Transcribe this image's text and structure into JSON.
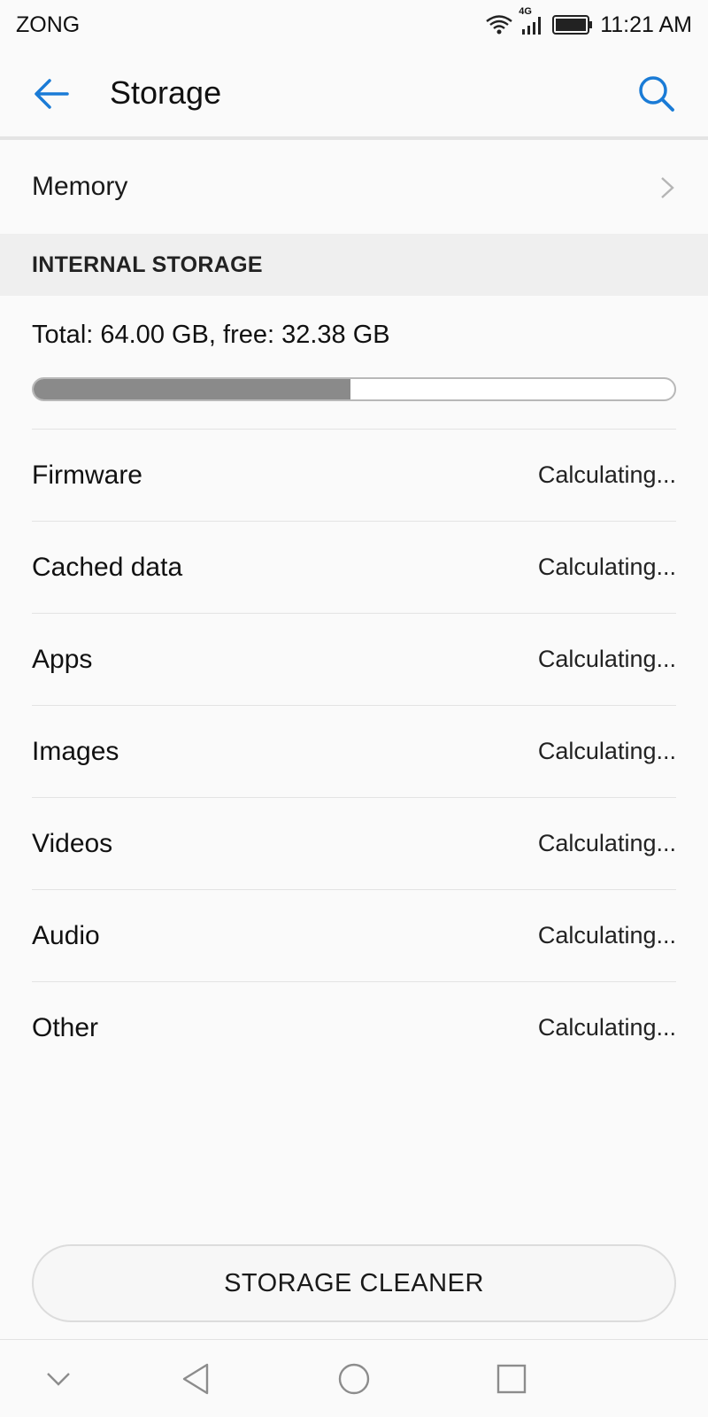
{
  "status_bar": {
    "carrier": "ZONG",
    "network": "4G",
    "time": "11:21 AM"
  },
  "app_bar": {
    "title": "Storage",
    "back_icon": "arrow-left-icon",
    "search_icon": "search-icon"
  },
  "memory": {
    "label": "Memory"
  },
  "internal_storage": {
    "header": "INTERNAL STORAGE",
    "total_text": "Total: 64.00 GB, free: 32.38 GB",
    "used_fraction": 0.494
  },
  "categories": [
    {
      "label": "Firmware",
      "value": "Calculating..."
    },
    {
      "label": "Cached data",
      "value": "Calculating..."
    },
    {
      "label": "Apps",
      "value": "Calculating..."
    },
    {
      "label": "Images",
      "value": "Calculating..."
    },
    {
      "label": "Videos",
      "value": "Calculating..."
    },
    {
      "label": "Audio",
      "value": "Calculating..."
    },
    {
      "label": "Other",
      "value": "Calculating..."
    }
  ],
  "storage_cleaner": {
    "label": "STORAGE CLEANER"
  },
  "colors": {
    "accent": "#1a7bd6",
    "progress_fill": "#8a8a8a"
  }
}
